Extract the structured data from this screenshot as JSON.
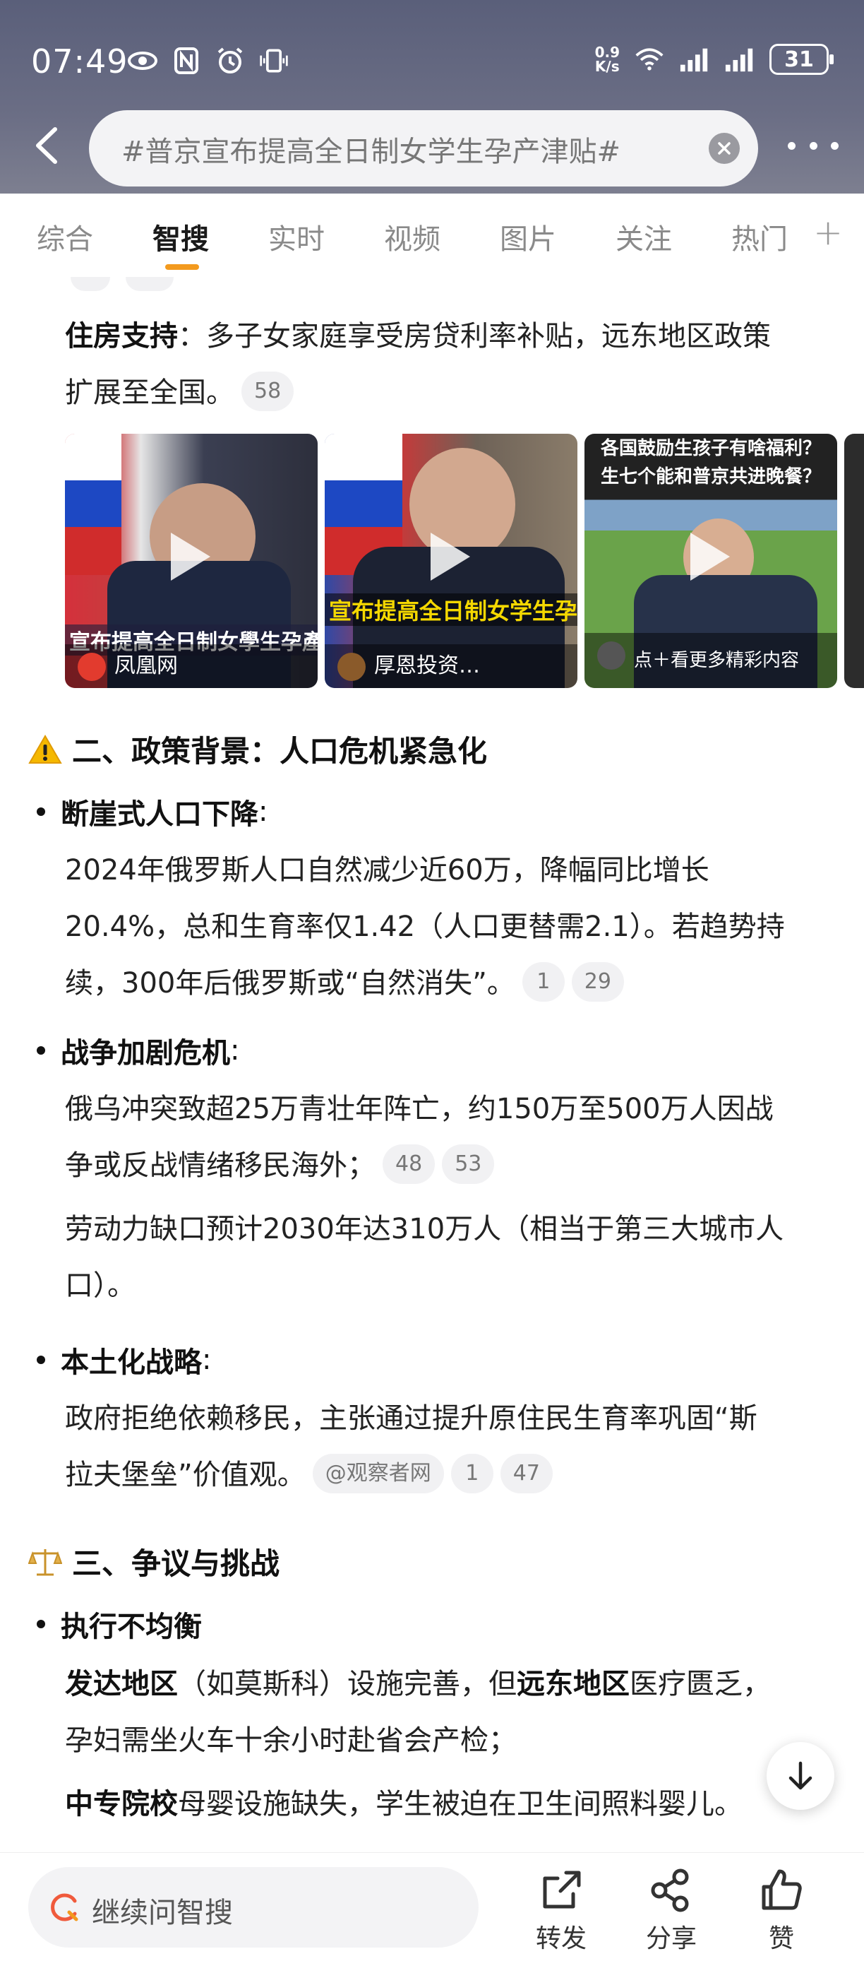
{
  "status": {
    "time": "07:49",
    "net_speed_value": "0.9",
    "net_speed_unit": "K/s",
    "battery": "31"
  },
  "search": {
    "query": "#普京宣布提高全日制女学生孕产津贴#"
  },
  "tabs": [
    "综合",
    "智搜",
    "实时",
    "视频",
    "图片",
    "关注",
    "热门"
  ],
  "active_tab": "智搜",
  "housing": {
    "label": "住房支持",
    "text_line1": "：多子女家庭享受房贷利率补贴，远东地区政策",
    "text_line2": "扩展至全国。",
    "cite": "58"
  },
  "videos": [
    {
      "caption": "宣布提高全日制女學生孕產津",
      "source": "凤凰网"
    },
    {
      "caption": "宣布提高全日制女学生孕产",
      "source": "厚恩投资…"
    },
    {
      "caption_top1": "各国鼓励生孩子有啥福利？",
      "caption_top2": "生七个能和普京共进晚餐？",
      "source": "点＋看更多精彩内容"
    }
  ],
  "section2": {
    "icon": "⚠️",
    "title": "二、政策背景：人口危机紧急化",
    "bullets": [
      {
        "head": "断崖式人口下降",
        "colon": ":",
        "line1": "2024年俄罗斯人口自然减少近60万，降幅同比增长",
        "line2": "20.4%，总和生育率仅1.42（人口更替需2.1）。若趋势持",
        "line3": "续，300年后俄罗斯或“自然消失”。",
        "cites": [
          "1",
          "29"
        ]
      },
      {
        "head": "战争加剧危机",
        "colon": ":",
        "line1": "俄乌冲突致超25万青壮年阵亡，约150万至500万人因战",
        "line2": "争或反战情绪移民海外；",
        "cites": [
          "48",
          "53"
        ],
        "line3": "劳动力缺口预计2030年达310万人（相当于第三大城市人",
        "line4": "口）。"
      },
      {
        "head": "本土化战略",
        "colon": ":",
        "line1": "政府拒绝依赖移民，主张通过提升原住民生育率巩固“斯",
        "line2": "拉夫堡垒”价值观。",
        "source_cite": "@观察者网",
        "cites": [
          "1",
          "47"
        ]
      }
    ]
  },
  "section3": {
    "icon": "⚖️",
    "title": "三、争议与挑战",
    "bullet_head": "执行不均衡",
    "p1_bold1": "发达地区",
    "p1_text1": "（如莫斯科）设施完善，但",
    "p1_bold2": "远东地区",
    "p1_text2": "医疗匮乏，",
    "p1_line2": "孕妇需坐火车十余小时赴省会产检；",
    "p2_bold": "中专院校",
    "p2_text": "母婴设施缺失，学生被迫在卫生间照料婴儿。"
  },
  "bottom": {
    "ask_placeholder": "继续问智搜",
    "repost": "转发",
    "share": "分享",
    "like": "赞"
  }
}
